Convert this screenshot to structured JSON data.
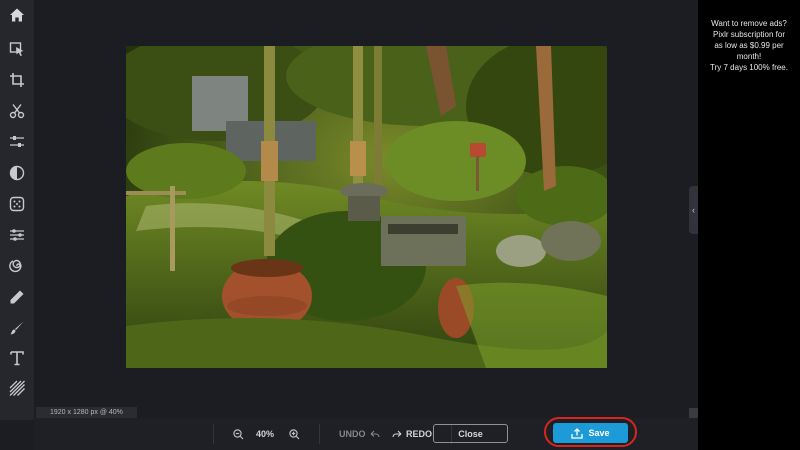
{
  "sidebar": {
    "tools": [
      {
        "name": "home-icon",
        "label": "Home"
      },
      {
        "name": "select-icon",
        "label": "Arrange"
      },
      {
        "name": "crop-icon",
        "label": "Crop"
      },
      {
        "name": "cut-icon",
        "label": "Cutout"
      },
      {
        "name": "adjust-icon",
        "label": "Adjust"
      },
      {
        "name": "filter-icon",
        "label": "Filter"
      },
      {
        "name": "effect-icon",
        "label": "Effect"
      },
      {
        "name": "retouch-icon",
        "label": "Retouch"
      },
      {
        "name": "liquify-icon",
        "label": "Liquify"
      },
      {
        "name": "draw-icon",
        "label": "Draw"
      },
      {
        "name": "brush-icon",
        "label": "Brush"
      },
      {
        "name": "text-icon",
        "label": "Text"
      },
      {
        "name": "pattern-icon",
        "label": "Pattern"
      }
    ]
  },
  "canvas": {
    "dimensions_label": "1920 x 1280 px @ 40%"
  },
  "ad": {
    "text": "Want to remove ads?\nPixlr subscription for\nas low as $0.99 per\nmonth!\nTry 7 days 100% free."
  },
  "bottombar": {
    "zoom_value": "40%",
    "undo_label": "UNDO",
    "redo_label": "REDO",
    "close_label": "Close",
    "save_label": "Save"
  },
  "colors": {
    "accent": "#1d9ad8",
    "highlight": "#d8261c",
    "sidebar_bg": "#26272c",
    "panel_bg": "#1c1d22"
  }
}
